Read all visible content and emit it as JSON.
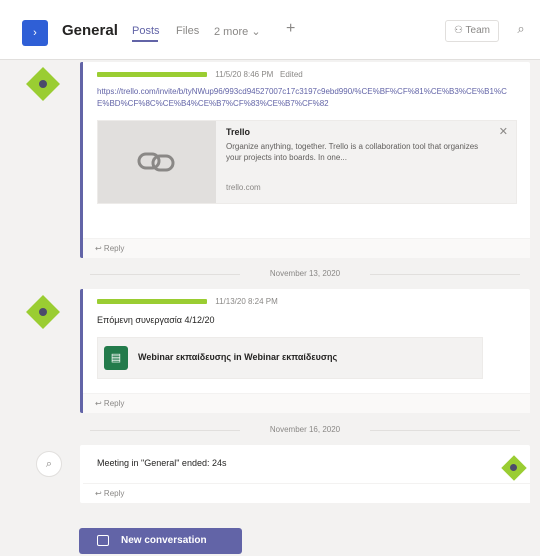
{
  "header": {
    "team_tile_icon": "›",
    "channel_name": "General",
    "tabs": [
      {
        "label": "Posts",
        "active": true
      },
      {
        "label": "Files",
        "active": false
      },
      {
        "label": "2 more",
        "active": false
      }
    ],
    "add_tab_icon": "+",
    "team_button_label": "⚇ Team",
    "meeting_icon": "⌕"
  },
  "messages": [
    {
      "timestamp": "11/5/20 8:46 PM",
      "edited": "Edited",
      "link": "https://trello.com/invite/b/tyNWup96/993cd94527007c17c3197c9ebd990/%CE%BF%CF%81%CE%B3%CE%B1%CE%BD%CF%8C%CE%B4%CE%B7%CF%83%CE%B7%CF%82",
      "preview": {
        "title": "Trello",
        "description": "Organize anything, together. Trello is a collaboration tool that organizes your projects into boards. In one...",
        "domain": "trello.com",
        "close_icon": "✕"
      },
      "reply_label": "↩ Reply"
    },
    {
      "timestamp": "11/13/20 8:24 PM",
      "text": "Επόμενη συνεργασία 4/12/20",
      "meeting_chip": {
        "icon": "▤",
        "label": "Webinar εκπαίδευσης in Webinar εκπαίδευσης"
      },
      "reply_label": "↩ Reply"
    },
    {
      "text": "Meeting in \"General\" ended: 24s",
      "reply_label": "↩ Reply"
    }
  ],
  "dividers": [
    "November 13, 2020",
    "November 16, 2020"
  ],
  "system_icon": "⌕",
  "new_conversation_label": "New conversation",
  "colors": {
    "accent": "#6264a7",
    "avatar": "#9acd32",
    "team_tile": "#2f5fd6",
    "meeting": "#237b4b"
  }
}
